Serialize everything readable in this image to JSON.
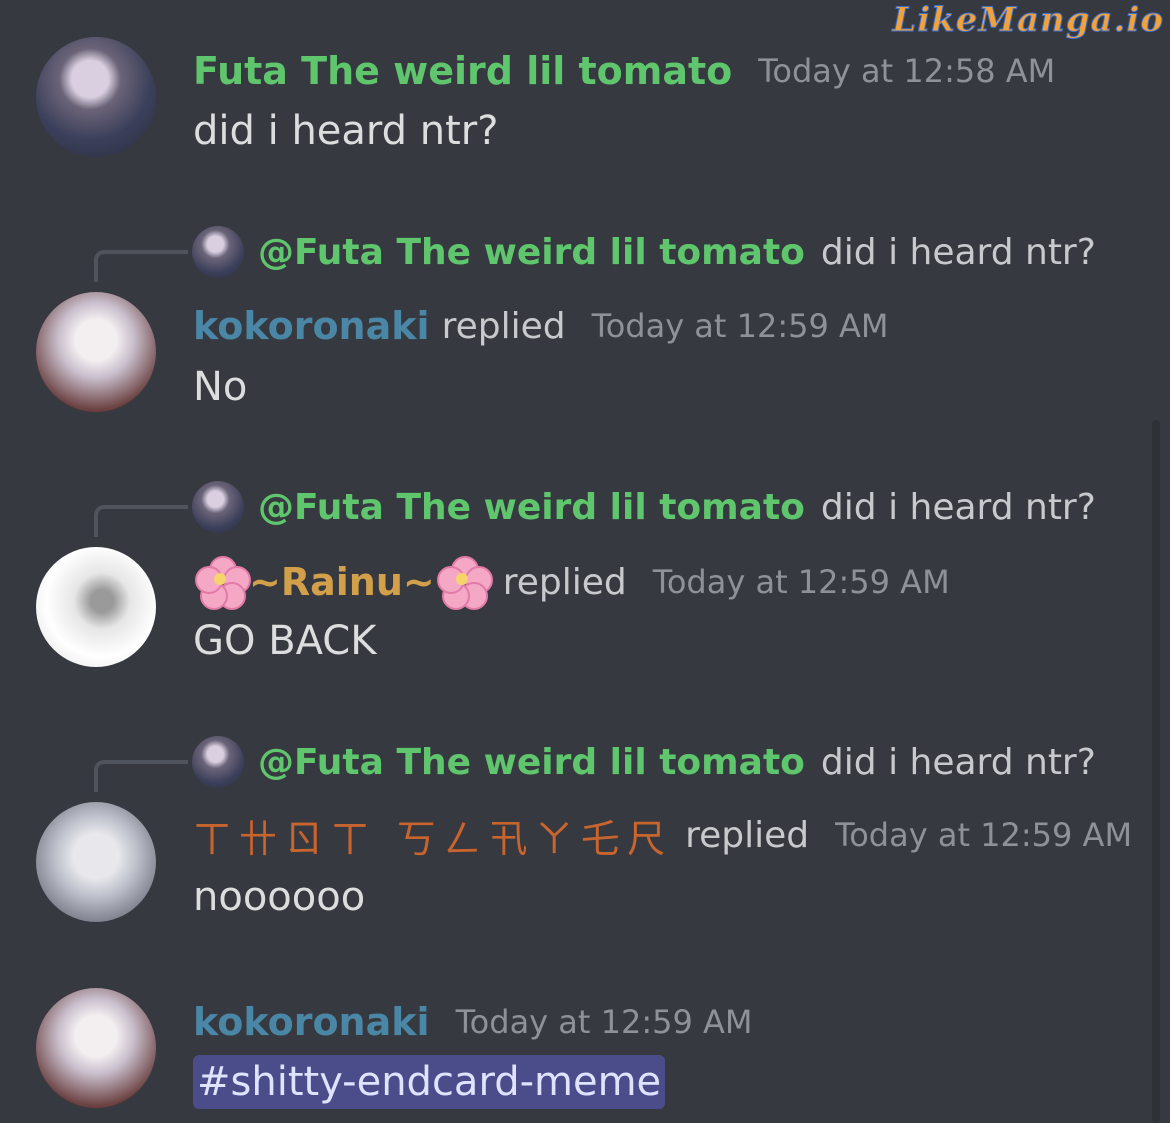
{
  "watermark": "LikeManga.io",
  "messages": [
    {
      "username": "Futa The weird lil tomato",
      "timestamp": "Today at 12:58 AM",
      "content": "did i heard ntr?"
    },
    {
      "reply_mention": "@Futa The weird lil tomato",
      "reply_text": "did i heard ntr?",
      "username": "kokoronaki",
      "replied": "replied",
      "timestamp": "Today at 12:59 AM",
      "content": "No"
    },
    {
      "reply_mention": "@Futa The weird lil tomato",
      "reply_text": "did i heard ntr?",
      "username": "~Rainu~",
      "replied": "replied",
      "timestamp": "Today at 12:59 AM",
      "content": "GO BACK"
    },
    {
      "reply_mention": "@Futa The weird lil tomato",
      "reply_text": "did i heard ntr?",
      "username": "ㄒ卄ㄖㄒ 丂ㄥ卂ㄚ乇尺",
      "replied": "replied",
      "timestamp": "Today at 12:59 AM",
      "content": "noooooo"
    },
    {
      "username": "kokoronaki",
      "timestamp": "Today at 12:59 AM",
      "channel_mention": "#shitty-endcard-meme"
    }
  ]
}
